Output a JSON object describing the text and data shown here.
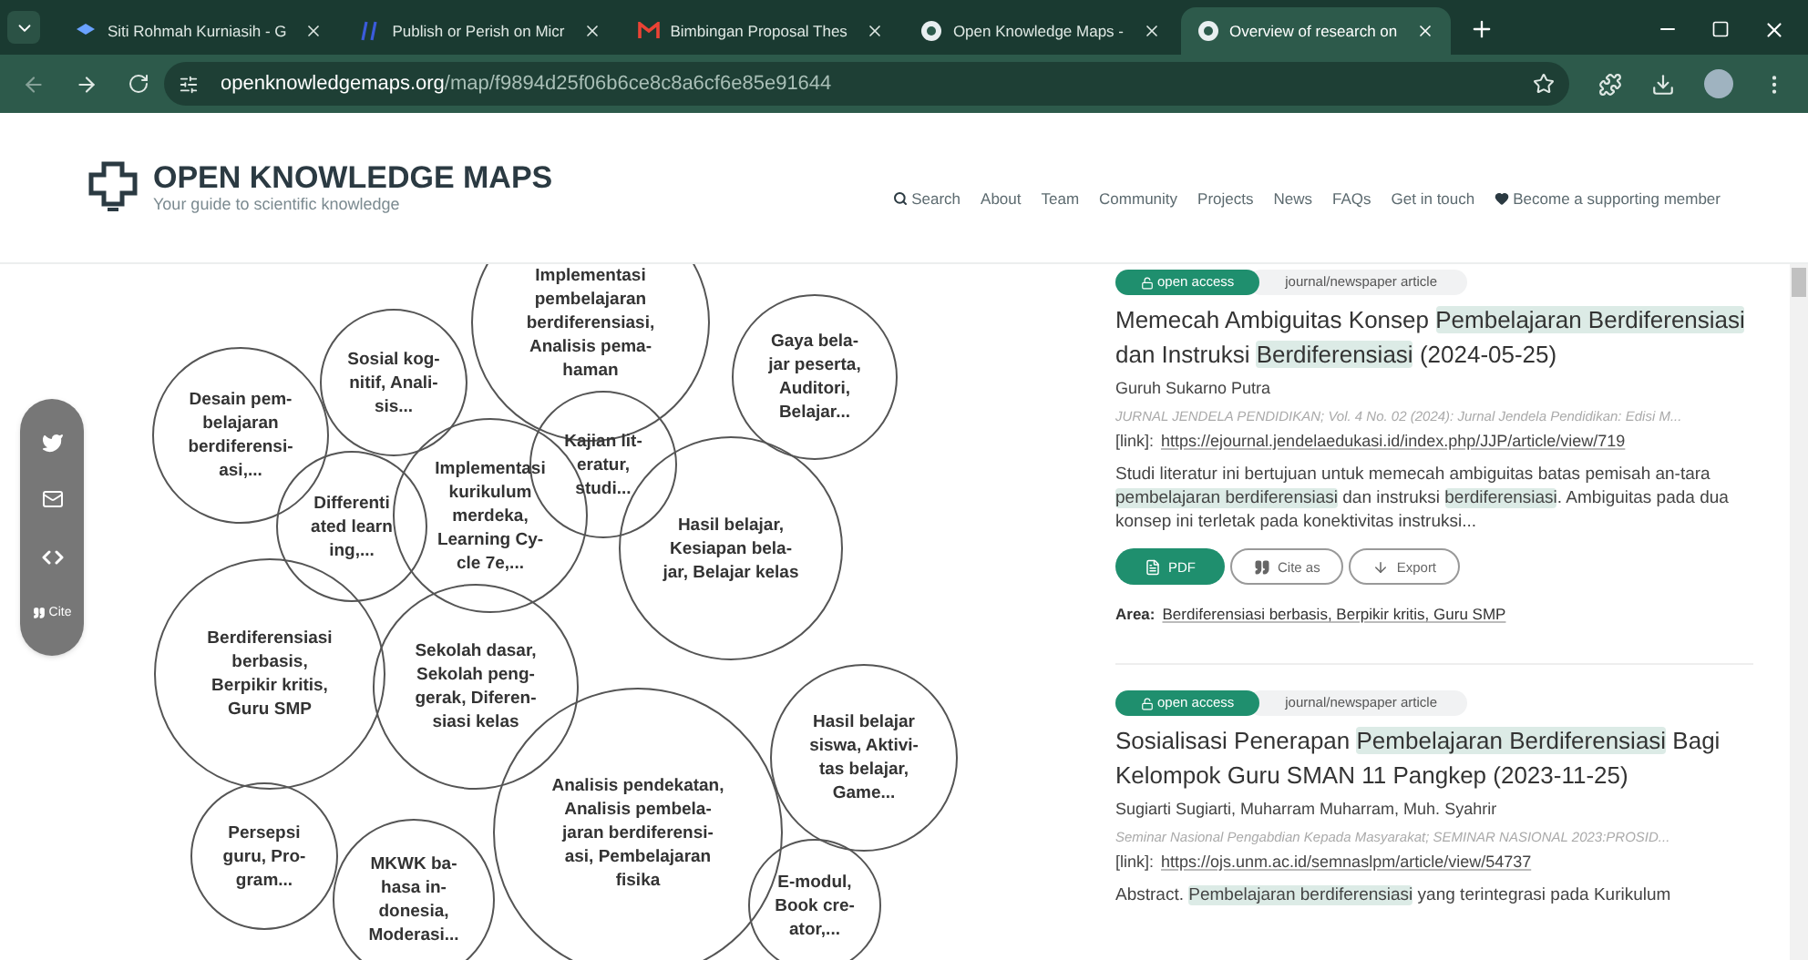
{
  "browser": {
    "tabs": [
      {
        "title": "Siti Rohmah Kurniasih - G",
        "selected": false
      },
      {
        "title": "Publish or Perish on Micr",
        "selected": false
      },
      {
        "title": "Bimbingan Proposal Thes",
        "selected": false
      },
      {
        "title": "Open Knowledge Maps -",
        "selected": false
      },
      {
        "title": "Overview of research on",
        "selected": true
      }
    ],
    "url_host": "openknowledgemaps.org",
    "url_path": "/map/f9894d25f06b6ce8c8a6cf6e85e91644"
  },
  "site": {
    "title": "OPEN KNOWLEDGE MAPS",
    "tagline": "Your guide to scientific knowledge",
    "nav": [
      "Search",
      "About",
      "Team",
      "Community",
      "Projects",
      "News",
      "FAQs",
      "Get in touch",
      "Become a supporting member"
    ]
  },
  "share": [
    {
      "kind": "twitter"
    },
    {
      "kind": "mail"
    },
    {
      "kind": "embed"
    },
    {
      "kind": "cite",
      "label": "Cite"
    }
  ],
  "bubbles": [
    {
      "lines": [
        "Implementasi",
        "pembelajaran",
        "berdiferensiasi,",
        "Analisis pema-",
        "haman"
      ]
    },
    {
      "lines": [
        "Sosial kog-",
        "nitif, Anali-",
        "sis..."
      ]
    },
    {
      "lines": [
        "Gaya bela-",
        "jar peserta,",
        "Auditori,",
        "Belajar..."
      ]
    },
    {
      "lines": [
        "Desain pem-",
        "belajaran",
        "berdiferensi-",
        "asi,..."
      ]
    },
    {
      "lines": [
        "Kajian lit-",
        "eratur,",
        "studi..."
      ]
    },
    {
      "lines": [
        "Differenti",
        "ated learn",
        "ing,..."
      ]
    },
    {
      "lines": [
        "Implementasi",
        "kurikulum",
        "merdeka,",
        "Learning Cy-",
        "cle 7e,..."
      ]
    },
    {
      "lines": [
        "Hasil belajar,",
        "Kesiapan bela-",
        "jar, Belajar kelas"
      ]
    },
    {
      "lines": [
        "Berdiferensiasi",
        "berbasis,",
        "Berpikir kritis,",
        "Guru SMP"
      ]
    },
    {
      "lines": [
        "Sekolah dasar,",
        "Sekolah peng-",
        "gerak, Diferen-",
        "siasi kelas"
      ]
    },
    {
      "lines": [
        "Hasil belajar",
        "siswa, Aktivi-",
        "tas belajar,",
        "Game..."
      ]
    },
    {
      "lines": [
        "Persepsi",
        "guru, Pro-",
        "gram..."
      ]
    },
    {
      "lines": [
        "MKWK ba-",
        "hasa in-",
        "donesia,",
        "Moderasi..."
      ]
    },
    {
      "lines": [
        "Analisis pendekatan,",
        "Analisis pembela-",
        "jaran berdiferensi-",
        "asi, Pembelajaran",
        "fisika"
      ]
    },
    {
      "lines": [
        "E-modul,",
        "Book cre-",
        "ator,..."
      ]
    }
  ],
  "papers": [
    {
      "access": "open access",
      "type": "journal/newspaper article",
      "title": [
        {
          "text": "Memecah Ambiguitas Konsep ",
          "highlight": false
        },
        {
          "text": "Pembelajaran Berdiferensiasi",
          "highlight": true
        },
        {
          "text": " dan Instruksi ",
          "highlight": false
        },
        {
          "text": "Berdiferensiasi",
          "highlight": true
        },
        {
          "text": " (2024-05-25)",
          "highlight": false
        }
      ],
      "authors": "Guruh Sukarno Putra",
      "source": "JURNAL JENDELA PENDIDIKAN; Vol. 4 No. 02 (2024): Jurnal Jendela Pendidikan: Edisi M...",
      "link_label": "[link]:",
      "link": "https://ejournal.jendelaedukasi.id/index.php/JJP/article/view/719",
      "abstract": [
        {
          "text": "Studi literatur ini bertujuan untuk memecah ambiguitas batas pemisah an-tara ",
          "highlight": false
        },
        {
          "text": "pembelajaran berdiferensiasi",
          "highlight": true
        },
        {
          "text": " dan instruksi ",
          "highlight": false
        },
        {
          "text": "berdiferensiasi",
          "highlight": true
        },
        {
          "text": ". Ambiguitas pada dua konsep ini terletak pada konektivitas instruksi...",
          "highlight": false
        }
      ],
      "buttons": [
        {
          "kind": "pdf",
          "label": "PDF"
        },
        {
          "kind": "cite",
          "label": "Cite as"
        },
        {
          "kind": "export",
          "label": "Export"
        }
      ],
      "area_label": "Area:",
      "area": "Berdiferensiasi berbasis, Berpikir kritis, Guru SMP"
    },
    {
      "access": "open access",
      "type": "journal/newspaper article",
      "title": [
        {
          "text": "Sosialisasi Penerapan ",
          "highlight": false
        },
        {
          "text": "Pembelajaran Berdiferensiasi",
          "highlight": true
        },
        {
          "text": " Bagi Kelompok Guru SMAN 11 Pangkep (2023-11-25)",
          "highlight": false
        }
      ],
      "authors": "Sugiarti Sugiarti, Muharram Muharram, Muh. Syahrir",
      "source": "Seminar Nasional Pengabdian Kepada Masyarakat; SEMINAR NASIONAL 2023:PROSID...",
      "link_label": "[link]:",
      "link": "https://ojs.unm.ac.id/semnaslpm/article/view/54737",
      "abstract": [
        {
          "text": "Abstract. ",
          "highlight": false
        },
        {
          "text": "Pembelajaran berdiferensiasi",
          "highlight": true
        },
        {
          "text": " yang terintegrasi pada Kurikulum",
          "highlight": false
        }
      ]
    }
  ]
}
